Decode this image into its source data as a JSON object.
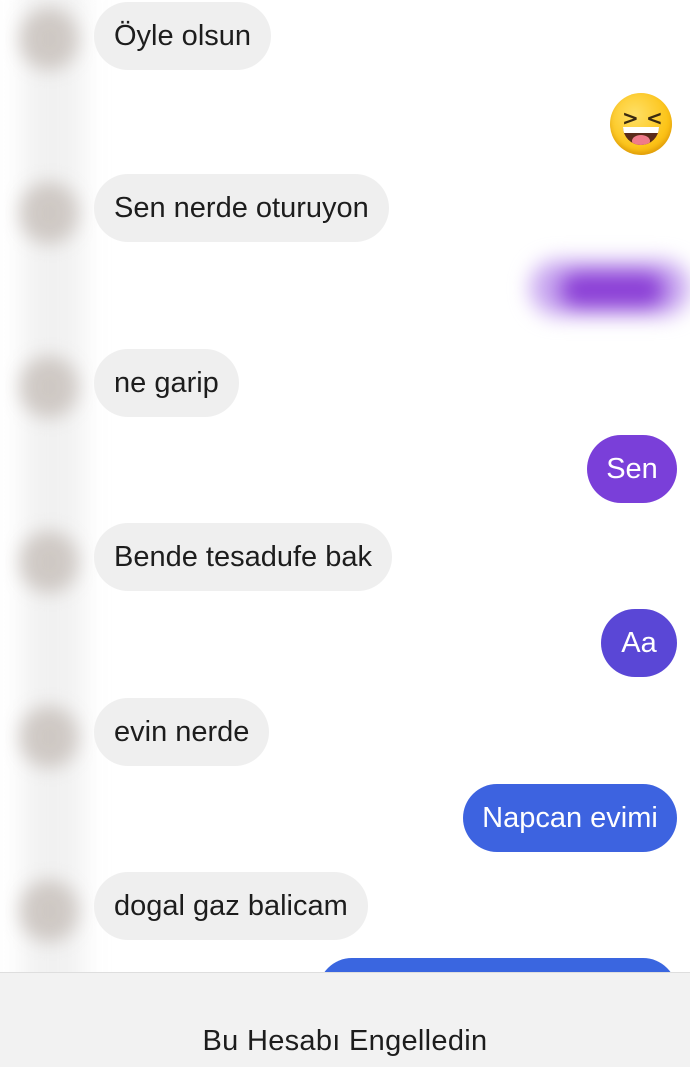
{
  "messages": {
    "incoming": [
      "Öyle olsun",
      "Sen nerde oturuyon",
      "ne garip",
      "Bende tesadufe bak",
      "evin nerde",
      "dogal gaz balicam"
    ],
    "outgoing": [
      "Sen",
      "Aa",
      "Napcan evimi"
    ],
    "emoji": "laughing-squinting-face"
  },
  "footer": {
    "blocked_label": "Bu Hesabı Engelledin"
  },
  "colors": {
    "incoming_bubble": "#efefef",
    "outgoing_purple": "#7a3fd9",
    "outgoing_violet": "#5a47d6",
    "outgoing_blue": "#3d63e0",
    "footer_bg": "#f2f2f2"
  }
}
